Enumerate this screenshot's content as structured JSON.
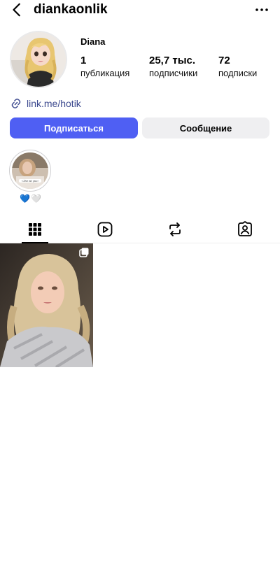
{
  "header": {
    "username": "diankaonlik",
    "back_icon": "chevron-left-icon",
    "more_icon": "more-horizontal-icon"
  },
  "profile": {
    "display_name": "Diana",
    "stats": [
      {
        "value": "1",
        "label": "публикация"
      },
      {
        "value": "25,7 тыс.",
        "label": "подписчики"
      },
      {
        "value": "72",
        "label": "подписки"
      }
    ],
    "link": "link.me/hotik"
  },
  "actions": {
    "subscribe_label": "Подписаться",
    "message_label": "Сообщение"
  },
  "highlight": {
    "label_hearts": [
      "💙",
      "🤍"
    ],
    "sticker_text": "☆Zhe rot yas☆"
  },
  "tabs": [
    {
      "icon": "grid-icon",
      "active": true
    },
    {
      "icon": "reels-icon",
      "active": false
    },
    {
      "icon": "reposts-icon",
      "active": false
    },
    {
      "icon": "tagged-icon",
      "active": false
    }
  ],
  "colors": {
    "primary_button": "#4f5ff3",
    "secondary_button": "#efeff1",
    "link": "#3d4a8f"
  }
}
